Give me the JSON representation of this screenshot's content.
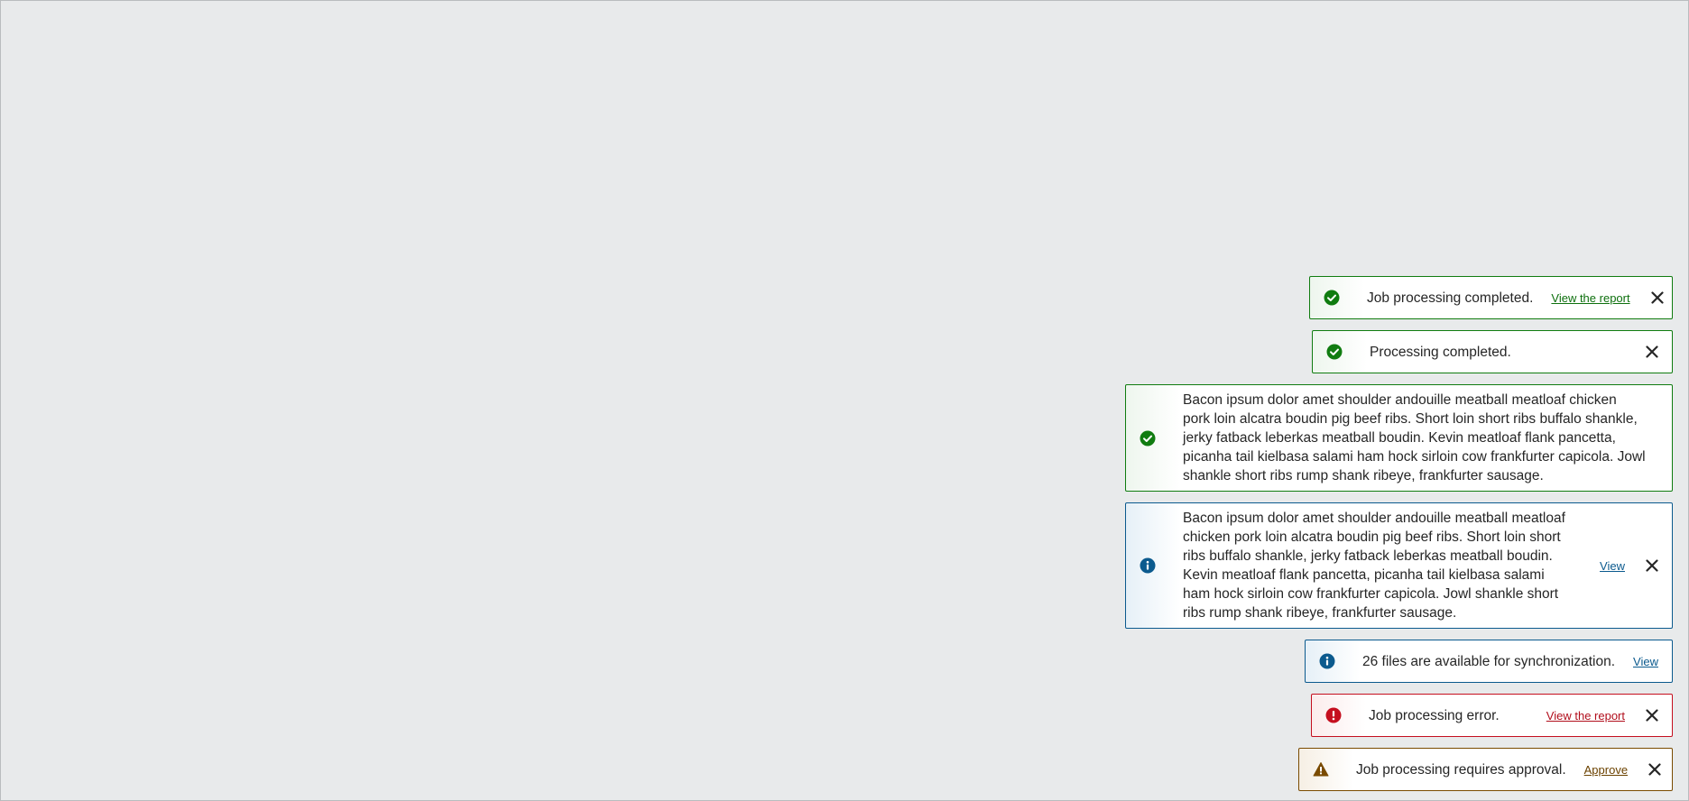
{
  "colors": {
    "background": "#e8eaeb",
    "success": "#107c10",
    "info": "#0b5a8e",
    "error": "#c50f1f",
    "warning": "#7a4b00"
  },
  "toasts": [
    {
      "type": "success",
      "icon": "success-check-icon",
      "message": "Job processing completed.",
      "action": "View the report",
      "dismissible": true
    },
    {
      "type": "success",
      "icon": "success-check-icon",
      "message": "Processing completed.",
      "action": "",
      "dismissible": true
    },
    {
      "type": "success",
      "icon": "success-check-icon",
      "message": "Bacon ipsum dolor amet shoulder andouille meatball meatloaf chicken pork loin alcatra boudin pig beef ribs. Short loin short ribs buffalo shankle, jerky fatback leberkas meatball boudin. Kevin meatloaf flank pancetta, picanha tail kielbasa salami ham hock sirloin cow frankfurter capicola. Jowl shankle short ribs rump shank ribeye, frankfurter sausage.",
      "action": "",
      "dismissible": false
    },
    {
      "type": "info",
      "icon": "info-icon",
      "message": "Bacon ipsum dolor amet shoulder andouille meatball meatloaf chicken pork loin alcatra boudin pig beef ribs. Short loin short ribs buffalo shankle, jerky fatback leberkas meatball boudin. Kevin meatloaf flank pancetta, picanha tail kielbasa salami ham hock sirloin cow frankfurter capicola. Jowl shankle short ribs rump shank ribeye, frankfurter sausage.",
      "action": "View",
      "dismissible": true
    },
    {
      "type": "info",
      "icon": "info-icon",
      "message": "26 files are available for synchronization.",
      "action": "View",
      "dismissible": false
    },
    {
      "type": "error",
      "icon": "error-icon",
      "message": "Job processing error.",
      "action": "View the report",
      "dismissible": true
    },
    {
      "type": "warning",
      "icon": "warning-icon",
      "message": "Job processing requires approval.",
      "action": "Approve",
      "dismissible": true
    }
  ]
}
